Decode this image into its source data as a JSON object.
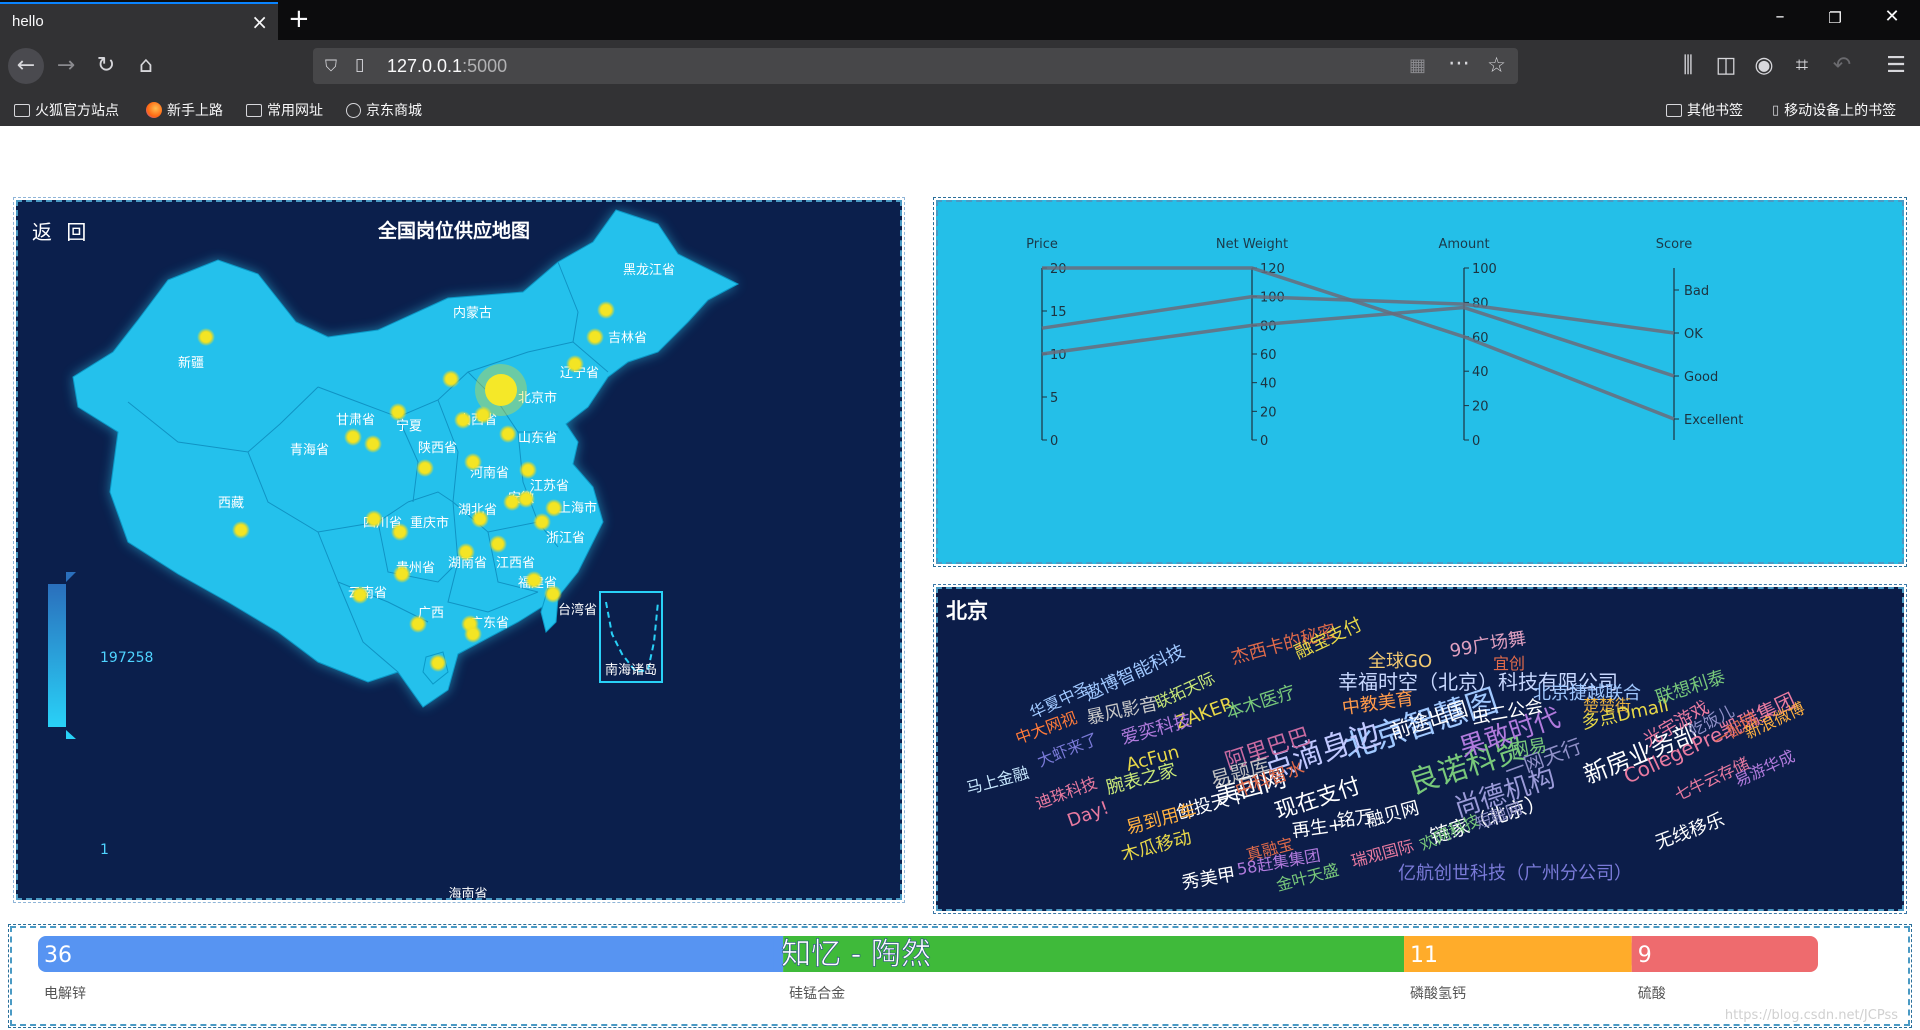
{
  "browser": {
    "tab_title": "hello",
    "tab_close": "×",
    "new_tab": "+",
    "url_host": "127.0.0.1",
    "url_port": ":5000",
    "window_controls": [
      "–",
      "❐",
      "✕"
    ],
    "bookmarks": [
      "火狐官方站点",
      "新手上路",
      "常用网址",
      "京东商城"
    ],
    "bookmarks_right": [
      "其他书签",
      "移动设备上的书签"
    ]
  },
  "map": {
    "back_label": "返 回",
    "title": "全国岗位供应地图",
    "legend_max": "197258",
    "legend_min": "1",
    "nanhai_label": "南海诸岛",
    "hainan_label": "海南省",
    "provinces": [
      "黑龙江省",
      "内蒙古",
      "吉林省",
      "辽宁省",
      "新疆",
      "甘肃省",
      "宁夏",
      "山西省",
      "北京市",
      "山东省",
      "陕西省",
      "青海省",
      "河南省",
      "江苏省",
      "西藏",
      "安徽",
      "上海市",
      "湖北省",
      "四川省",
      "重庆市",
      "浙江省",
      "贵州省",
      "湖南省",
      "江西省",
      "福建省",
      "云南省",
      "广西",
      "台湾省",
      "广东省"
    ]
  },
  "parallel": {
    "axes": [
      {
        "name": "Price",
        "ticks": [
          "20",
          "15",
          "10",
          "5",
          "0"
        ]
      },
      {
        "name": "Net Weight",
        "ticks": [
          "120",
          "100",
          "80",
          "60",
          "40",
          "20",
          "0"
        ]
      },
      {
        "name": "Amount",
        "ticks": [
          "100",
          "80",
          "60",
          "40",
          "20",
          "0"
        ]
      },
      {
        "name": "Score",
        "ticks": [
          "Bad",
          "OK",
          "Good",
          "Excellent"
        ]
      }
    ],
    "lines": [
      {
        "price": 20,
        "net_weight": 120,
        "amount": 60,
        "score": "Excellent"
      },
      {
        "price": 13,
        "net_weight": 100,
        "amount": 79,
        "score": "OK"
      },
      {
        "price": 10,
        "net_weight": 80,
        "amount": 77,
        "score": "Good"
      }
    ]
  },
  "cloud": {
    "city": "北京",
    "words": [
      {
        "t": "北京智慧图",
        "c": "#a0c8ff"
      },
      {
        "t": "点滴身边",
        "c": "#c0c8ff"
      },
      {
        "t": "良诺科贸",
        "c": "#78c87a"
      },
      {
        "t": "果敢时代",
        "c": "#b07adc"
      },
      {
        "t": "美团网",
        "c": "#ffffff"
      },
      {
        "t": "尚德机构",
        "c": "#9a9ad8"
      },
      {
        "t": "新房业务部",
        "c": "#ffffff"
      },
      {
        "t": "CollegePre凯瑞集团",
        "c": "#e87aa0"
      },
      {
        "t": "幸福时空（北京）科技有限公司",
        "c": "#c8d8ff"
      },
      {
        "t": "阿里巴巴",
        "c": "#c86aa0"
      },
      {
        "t": "现在支付",
        "c": "#ffffff"
      },
      {
        "t": "前途出国",
        "c": "#ffffff"
      },
      {
        "t": "易题库",
        "c": "#c0c0c0"
      },
      {
        "t": "创投天下",
        "c": "#ffffff"
      },
      {
        "t": "一网天行",
        "c": "#9090c8"
      },
      {
        "t": "融贝网",
        "c": "#ffffff"
      },
      {
        "t": "链家（北京）",
        "c": "#ffffff"
      },
      {
        "t": "杰西卡的秘密",
        "c": "#e06a4a"
      },
      {
        "t": "融宝支付",
        "c": "#e8d848"
      },
      {
        "t": "全球GO",
        "c": "#f0c870"
      },
      {
        "t": "99广场舞",
        "c": "#e0a0c0"
      },
      {
        "t": "宜创",
        "c": "#e06a4a"
      },
      {
        "t": "遨博智能科技",
        "c": "#a0c8ff"
      },
      {
        "t": "华夏中圣",
        "c": "#a0c8ff"
      },
      {
        "t": "联拓天际",
        "c": "#c8e878"
      },
      {
        "t": "北京捷越联合",
        "c": "#a0c8ff"
      },
      {
        "t": "楚楚街",
        "c": "#e8b040"
      },
      {
        "t": "中大网视",
        "c": "#ff7a3a"
      },
      {
        "t": "暴风影音",
        "c": "#c8c8c8"
      },
      {
        "t": "ZAKER",
        "c": "#e8d848"
      },
      {
        "t": "本木医疗",
        "c": "#78c87a"
      },
      {
        "t": "中教美育",
        "c": "#ff9a4a"
      },
      {
        "t": "虫二公会",
        "c": "#ffffff"
      },
      {
        "t": "多点Dmall",
        "c": "#e8d848"
      },
      {
        "t": "联想利泰",
        "c": "#78c87a"
      },
      {
        "t": "大虾来了",
        "c": "#7a7ad8"
      },
      {
        "t": "爱奕科技",
        "c": "#b07adc"
      },
      {
        "t": "马上金融",
        "c": "#c8e8ff"
      },
      {
        "t": "AcFun",
        "c": "#e8d848"
      },
      {
        "t": "腕表之家",
        "c": "#c8e878"
      },
      {
        "t": "网易",
        "c": "#78c87a"
      },
      {
        "t": "光宇游戏",
        "c": "#e87aa0"
      },
      {
        "t": "吃饭儿",
        "c": "#9090c8"
      },
      {
        "t": "一配网",
        "c": "#e06a4a"
      },
      {
        "t": "新浪微博",
        "c": "#ffb040"
      },
      {
        "t": "迪珠科技",
        "c": "#e87aa0"
      },
      {
        "t": "Day!",
        "c": "#e87aa0"
      },
      {
        "t": "中科智水",
        "c": "#e06a4a"
      },
      {
        "t": "易到用车",
        "c": "#ffb040"
      },
      {
        "t": "再生+",
        "c": "#ffffff"
      },
      {
        "t": "铭万",
        "c": "#ffffff"
      },
      {
        "t": "欢网科技",
        "c": "#78c87a"
      },
      {
        "t": "短融网",
        "c": "#9090c8"
      },
      {
        "t": "七牛云存储",
        "c": "#e87aa0"
      },
      {
        "t": "易游华成",
        "c": "#b07adc"
      },
      {
        "t": "木瓜移动",
        "c": "#e8d848"
      },
      {
        "t": "真融宝",
        "c": "#e06a4a"
      },
      {
        "t": "瑞观国际",
        "c": "#e87aa0"
      },
      {
        "t": "秀美甲",
        "c": "#ffffff"
      },
      {
        "t": "58赶集集团",
        "c": "#b07adc"
      },
      {
        "t": "金叶天盛",
        "c": "#78c87a"
      },
      {
        "t": "亿航创世科技（广州分公司）",
        "c": "#7a7ad8"
      },
      {
        "t": "无线移乐",
        "c": "#ffffff"
      }
    ]
  },
  "bar": {
    "center_label": "知忆 - 陶然",
    "watermark": "https://blog.csdn.net/JCPss",
    "segments": [
      {
        "name": "电解锌",
        "value": 36,
        "color": "#5794f2",
        "label": "36"
      },
      {
        "name": "硅锰合金",
        "value": 30,
        "color": "#3fba3a",
        "label": ""
      },
      {
        "name": "磷酸氢钙",
        "value": 11,
        "color": "#ffac2a",
        "label": "11"
      },
      {
        "name": "硫酸",
        "value": 9,
        "color": "#ee6b6e",
        "label": "9"
      }
    ]
  }
}
